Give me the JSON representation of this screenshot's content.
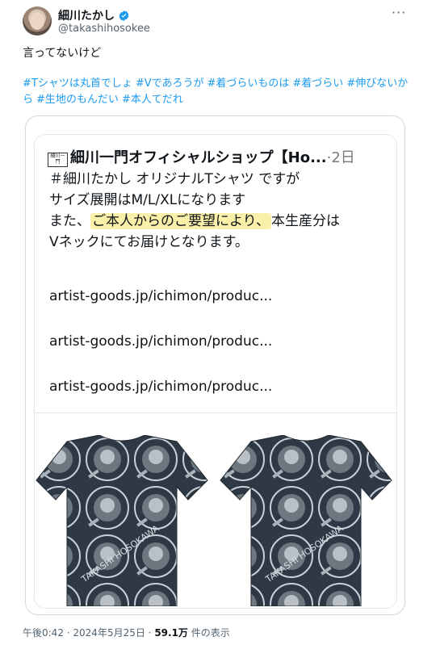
{
  "author": {
    "name": "細川たかし",
    "handle": "@takashihosokee",
    "verified": true
  },
  "tweet": {
    "text": "言ってないけど",
    "hashtags": [
      "#Tシャツは丸首でしょ",
      "#Vであろうが",
      "#着づらいものは",
      "#着づらい",
      "#伸びないから",
      "#生地のもんだい",
      "#本人てだれ"
    ]
  },
  "quoted_card": {
    "logo_text": "細川一門",
    "title": "細川一門オフィシャルショップ【Ho...",
    "time_ago": "·2日",
    "body_line1": "＃細川たかし オリジナルTシャツ ですが",
    "body_line2": "サイズ展開はM/L/XLになります",
    "body_line3_pre": "また、",
    "body_line3_highlight": "ご本人からのご要望により、",
    "body_line3_post": "本生産分は",
    "body_line4": "Vネックにてお届けとなります。",
    "links": [
      "artist-goods.jp/ichimon/produc...",
      "artist-goods.jp/ichimon/produc...",
      "artist-goods.jp/ichimon/produc..."
    ],
    "shirt_print_text": "TAKASHI HOSOKAWA"
  },
  "meta": {
    "time": "午後0:42",
    "date": "2024年5月25日",
    "views": "59.1万",
    "views_label": "件の表示"
  },
  "colors": {
    "link_blue": "#1d9bf0",
    "highlight": "#fbf0a9",
    "shirt_dark": "#2e3945"
  }
}
